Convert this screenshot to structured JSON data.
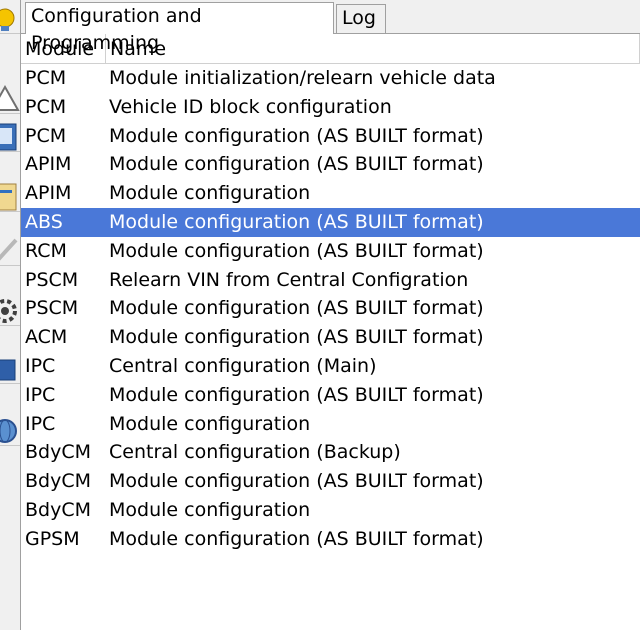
{
  "tabs": [
    {
      "label": "Configuration and Programming",
      "active": true
    },
    {
      "label": "Log",
      "active": false
    }
  ],
  "table": {
    "headers": {
      "module": "Module",
      "name": "Name"
    },
    "selected_index": 5,
    "rows": [
      {
        "module": "PCM",
        "name": "Module initialization/relearn vehicle data"
      },
      {
        "module": "PCM",
        "name": "Vehicle ID block configuration"
      },
      {
        "module": "PCM",
        "name": "Module configuration (AS BUILT format)"
      },
      {
        "module": "APIM",
        "name": "Module configuration (AS BUILT format)"
      },
      {
        "module": "APIM",
        "name": "Module configuration"
      },
      {
        "module": "ABS",
        "name": "Module configuration (AS BUILT format)"
      },
      {
        "module": "RCM",
        "name": "Module configuration (AS BUILT format)"
      },
      {
        "module": "PSCM",
        "name": "Relearn VIN from Central Configration"
      },
      {
        "module": "PSCM",
        "name": "Module configuration (AS BUILT format)"
      },
      {
        "module": "ACM",
        "name": "Module configuration (AS BUILT format)"
      },
      {
        "module": "IPC",
        "name": "Central configuration (Main)"
      },
      {
        "module": "IPC",
        "name": "Module configuration (AS BUILT format)"
      },
      {
        "module": "IPC",
        "name": "Module configuration"
      },
      {
        "module": "BdyCM",
        "name": "Central configuration (Backup)"
      },
      {
        "module": "BdyCM",
        "name": "Module configuration (AS BUILT format)"
      },
      {
        "module": "BdyCM",
        "name": "Module configuration"
      },
      {
        "module": "GPSM",
        "name": "Module configuration (AS BUILT format)"
      }
    ]
  },
  "colors": {
    "selection": "#4a78d8",
    "selection_text": "#ffffff"
  },
  "toolbar_icons": [
    "lightbulb-icon",
    "warning-icon",
    "document-icon",
    "scroll-icon",
    "wrench-icon",
    "gear-icon",
    "puzzle-icon",
    "globe-icon"
  ]
}
